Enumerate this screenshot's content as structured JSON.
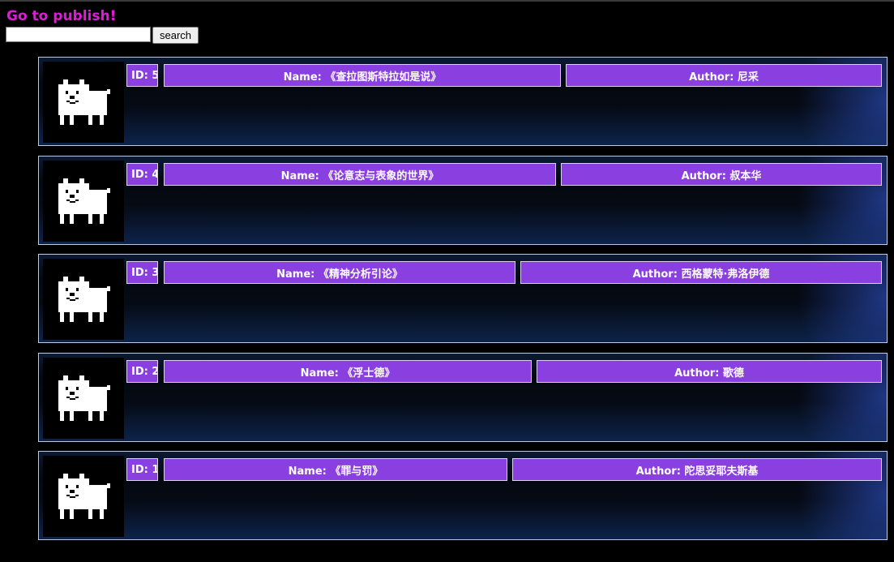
{
  "header": {
    "publish_link": "Go to publish!",
    "search_placeholder": "",
    "search_button": "search"
  },
  "books": [
    {
      "id": "ID: 5",
      "name": "Name: 《查拉图斯特拉如是说》",
      "author": "Author: 尼采"
    },
    {
      "id": "ID: 4",
      "name": "Name: 《论意志与表象的世界》",
      "author": "Author: 叔本华"
    },
    {
      "id": "ID: 3",
      "name": "Name: 《精神分析引论》",
      "author": "Author: 西格蒙特·弗洛伊德"
    },
    {
      "id": "ID: 2",
      "name": "Name: 《浮士德》",
      "author": "Author: 歌德"
    },
    {
      "id": "ID: 1",
      "name": "Name: 《罪与罚》",
      "author": "Author: 陀思妥耶夫斯基"
    }
  ],
  "colors": {
    "link": "#e01ad8",
    "field_bg": "#8a3fe0",
    "card_border": "#b9c9e6",
    "page_bg": "#000000"
  },
  "icons": {
    "cover": "white-pixel-dog-icon"
  }
}
